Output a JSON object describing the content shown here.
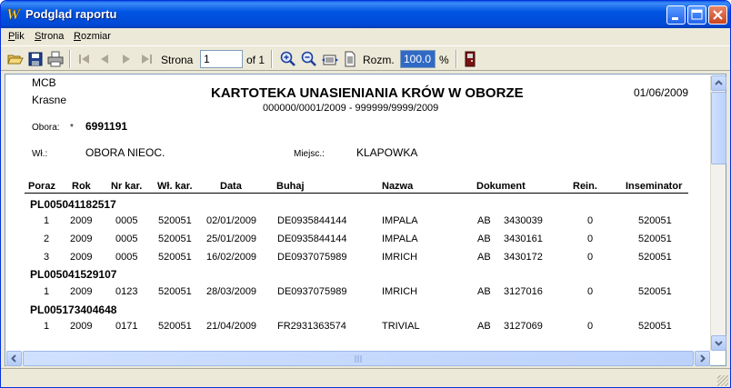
{
  "window": {
    "title": "Podgląd raportu"
  },
  "menu": [
    "Plik",
    "Strona",
    "Rozmiar"
  ],
  "toolbar": {
    "page_label": "Strona",
    "page_value": "1",
    "page_of": "of 1",
    "zoom_label": "Rozm.",
    "zoom_value": "100.0",
    "zoom_unit": "%"
  },
  "report": {
    "company_line1": "MCB",
    "company_line2": "Krasne",
    "title": "KARTOTEKA UNASIENIANIA KRÓW W OBORZE",
    "subtitle": "000000/0001/2009  -  999999/9999/2009",
    "date": "01/06/2009",
    "obora_label": "Obora:",
    "obora_mark": "*",
    "obora_value": "6991191",
    "wl_label": "Wł.:",
    "wl_value": "OBORA  NIEOC.",
    "miejsc_label": "Miejsc.:",
    "miejsc_value": "KLAPOWKA",
    "columns": [
      "Poraz",
      "Rok",
      "Nr kar.",
      "Wł. kar.",
      "Data",
      "Buhaj",
      "Nazwa",
      "Dokument",
      "Rein.",
      "Inseminator"
    ],
    "groups": [
      {
        "id": "PL005041182517",
        "rows": [
          [
            "1",
            "2009",
            "0005",
            "520051",
            "02/01/2009",
            "DE0935844144",
            "IMPALA",
            "AB",
            "3430039",
            "0",
            "520051"
          ],
          [
            "2",
            "2009",
            "0005",
            "520051",
            "25/01/2009",
            "DE0935844144",
            "IMPALA",
            "AB",
            "3430161",
            "0",
            "520051"
          ],
          [
            "3",
            "2009",
            "0005",
            "520051",
            "16/02/2009",
            "DE0937075989",
            "IMRICH",
            "AB",
            "3430172",
            "0",
            "520051"
          ]
        ]
      },
      {
        "id": "PL005041529107",
        "rows": [
          [
            "1",
            "2009",
            "0123",
            "520051",
            "28/03/2009",
            "DE0937075989",
            "IMRICH",
            "AB",
            "3127016",
            "0",
            "520051"
          ]
        ]
      },
      {
        "id": "PL005173404648",
        "rows": [
          [
            "1",
            "2009",
            "0171",
            "520051",
            "21/04/2009",
            "FR2931363574",
            "TRIVIAL",
            "AB",
            "3127069",
            "0",
            "520051"
          ]
        ]
      }
    ]
  },
  "colors": {
    "titlebar": "#0054e3",
    "chrome": "#ece9d8",
    "zoom_highlight": "#316ac5"
  },
  "icons": [
    "app-icon",
    "open-icon",
    "save-icon",
    "print-icon",
    "first-page-icon",
    "prev-page-icon",
    "next-page-icon",
    "last-page-icon",
    "zoom-in-icon",
    "zoom-out-icon",
    "page-width-icon",
    "full-page-icon",
    "exit-icon",
    "minimize-icon",
    "maximize-icon",
    "close-icon"
  ]
}
